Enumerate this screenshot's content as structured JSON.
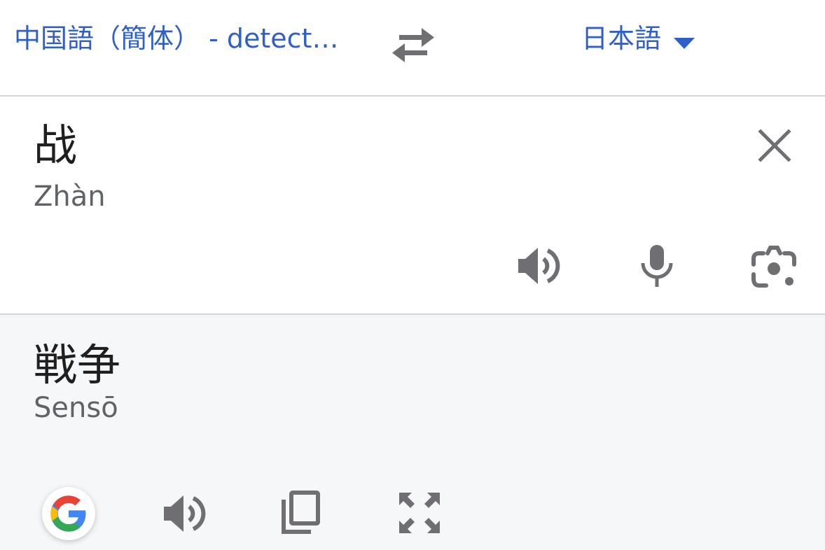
{
  "header": {
    "source_language": "中国語（簡体） - detect…",
    "target_language": "日本語"
  },
  "input": {
    "text": "战",
    "romanization": "Zhàn"
  },
  "output": {
    "text": "戦争",
    "romanization": "Sensō"
  },
  "colors": {
    "accent": "#2f5fc9",
    "icon": "#6e6e73",
    "output_bg": "#f6f7f9",
    "divider": "#d4d4d6"
  },
  "icons": {
    "swap": "swap-arrows-icon",
    "dropdown": "caret-down-icon",
    "clear": "close-icon",
    "speak_input": "speaker-icon",
    "mic": "microphone-icon",
    "camera": "camera-lens-icon",
    "google": "google-logo",
    "speak_output": "speaker-icon",
    "copy": "copy-icon",
    "fullscreen": "fullscreen-icon"
  }
}
